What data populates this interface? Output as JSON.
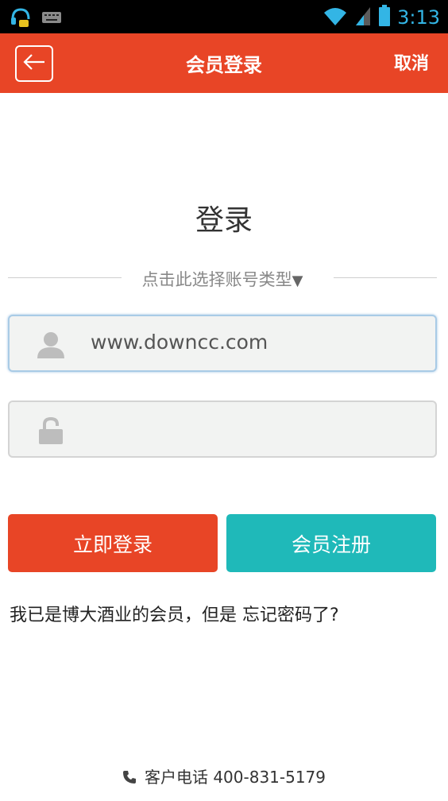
{
  "status_bar": {
    "time": "3:13"
  },
  "header": {
    "title": "会员登录",
    "cancel_label": "取消"
  },
  "login": {
    "title": "登录",
    "account_type_prompt": "点击此选择账号类型",
    "username_value": "www.downcc.com",
    "password_value": "",
    "login_button": "立即登录",
    "register_button": "会员注册",
    "forgot_prefix": "我已是博大酒业的会员，但是",
    "forgot_link": "忘记密码了?"
  },
  "footer": {
    "phone_label": "客户电话 400-831-5179"
  },
  "colors": {
    "accent": "#e84526",
    "teal": "#1fb9b9",
    "status_blue": "#33b5e5"
  }
}
